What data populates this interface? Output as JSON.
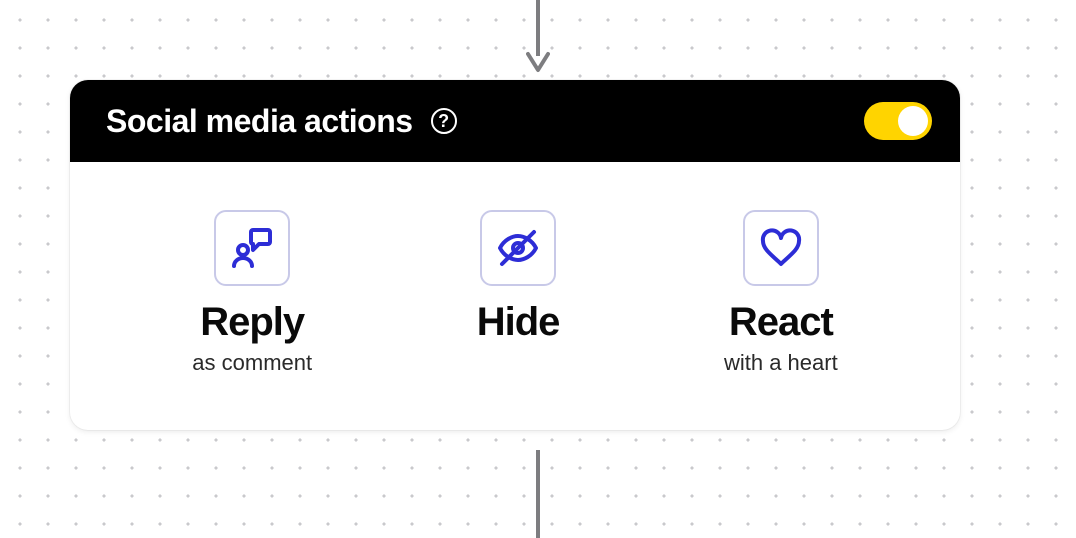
{
  "node": {
    "title": "Social media actions",
    "help_glyph": "?",
    "toggle_on": true
  },
  "actions": [
    {
      "title": "Reply",
      "subtitle": "as comment",
      "icon": "speak-person"
    },
    {
      "title": "Hide",
      "subtitle": "",
      "icon": "eye-off"
    },
    {
      "title": "React",
      "subtitle": "with a heart",
      "icon": "heart"
    }
  ],
  "colors": {
    "accent_icon": "#2d2dd6",
    "toggle_on": "#ffd400",
    "edge": "#7d7d80"
  }
}
